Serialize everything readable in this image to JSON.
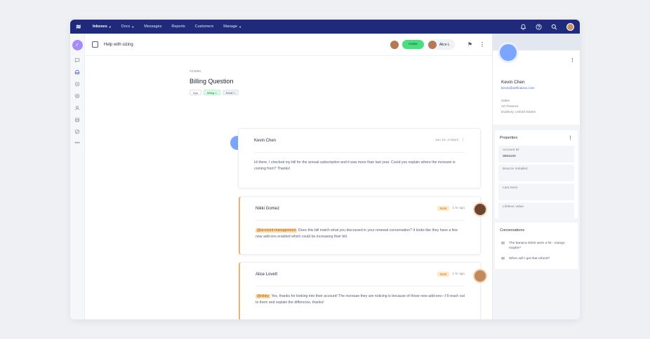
{
  "topnav": {
    "items": [
      {
        "label": "Inboxes",
        "caret": true
      },
      {
        "label": "Docs",
        "caret": true
      },
      {
        "label": "Messages",
        "caret": false
      },
      {
        "label": "Reports",
        "caret": false
      },
      {
        "label": "Customers",
        "caret": false
      },
      {
        "label": "Manage",
        "caret": true
      }
    ]
  },
  "toolbar": {
    "title": "Help with sizing",
    "status": "Active",
    "assignee": "Alice L"
  },
  "ticket": {
    "id": "#23886",
    "title": "Billing Question",
    "tags": [
      "App",
      "billing",
      "email"
    ]
  },
  "thread": [
    {
      "author": "Kevin Chen",
      "time": "Jun 10, 2:44pm",
      "type": "message",
      "body": "Hi there, I checked my bill for the annual subscription and it was more than last year. Could you explain where the increase is coming from? Thanks!"
    },
    {
      "author": "Nikki Gomez",
      "time": "1 hr ago",
      "type": "note",
      "badge": "Note",
      "mention": "@account-management",
      "body": " Does this bill match what you discussed in your renewal conversation? It looks like they have a few new add-ons enabled which could be increasing their bill."
    },
    {
      "author": "Alice Lovett",
      "time": "1 hr ago",
      "type": "note",
      "badge": "Note",
      "mention": "@nikky",
      "body": " Yes, thanks for looking into their account! The increase they are noticing is because of those new add-ons—I'll reach out to them and explain the difference, thanks!"
    }
  ],
  "profile": {
    "name": "Kevin Chen",
    "email": "kevin@artfinance.com",
    "lines": [
      "Sales",
      "Art Finance",
      "Duxbury, United States"
    ]
  },
  "properties": {
    "title": "Properties",
    "items": [
      {
        "label": "Account ID",
        "value": "0064100"
      },
      {
        "label": "Beacon Installed",
        "value": ""
      },
      {
        "label": "Last Seen",
        "value": ""
      },
      {
        "label": "Lifetime Value",
        "value": ""
      }
    ]
  },
  "conversations": {
    "title": "Conversations",
    "items": [
      "The banana shirts were a hit - mango maybe?",
      "When will I get that refund?"
    ]
  },
  "colors": {
    "nav": "#1f2b7a",
    "accent": "#4059d6",
    "status": "#4ade80",
    "note": "#f5b16a"
  }
}
